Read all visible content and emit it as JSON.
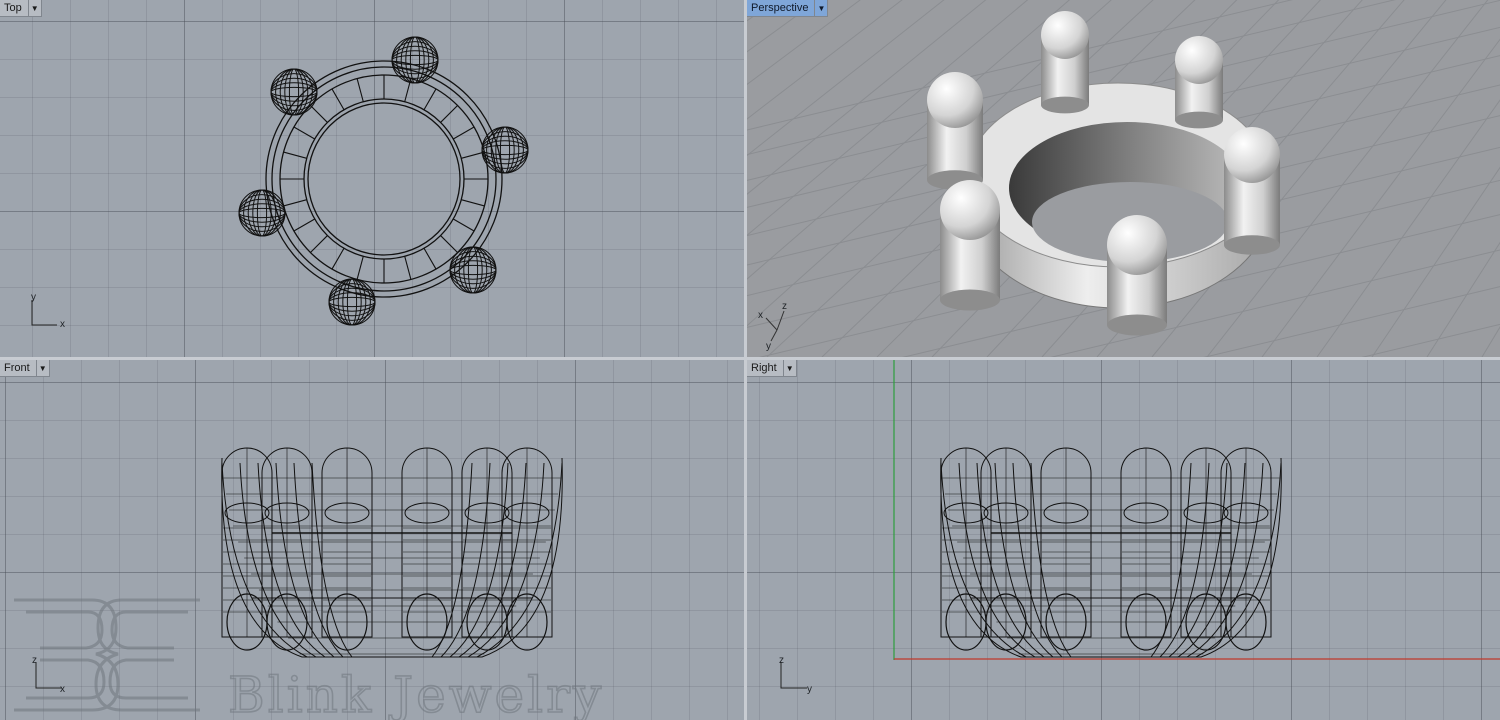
{
  "viewports": {
    "top": {
      "title": "Top",
      "axes": [
        "y",
        "x"
      ]
    },
    "persp": {
      "title": "Perspective",
      "axes": [
        "x",
        "z",
        "y"
      ]
    },
    "front": {
      "title": "Front",
      "axes": [
        "z",
        "x"
      ]
    },
    "right": {
      "title": "Right",
      "axes": [
        "z",
        "y"
      ]
    }
  },
  "watermark": {
    "text": "Blink Jewelry"
  },
  "colors": {
    "viewport_bg": "#9ea5ae",
    "active_tab": "#7fa6d8",
    "x_axis": "#c0392b",
    "y_axis": "#2e9e3e"
  }
}
